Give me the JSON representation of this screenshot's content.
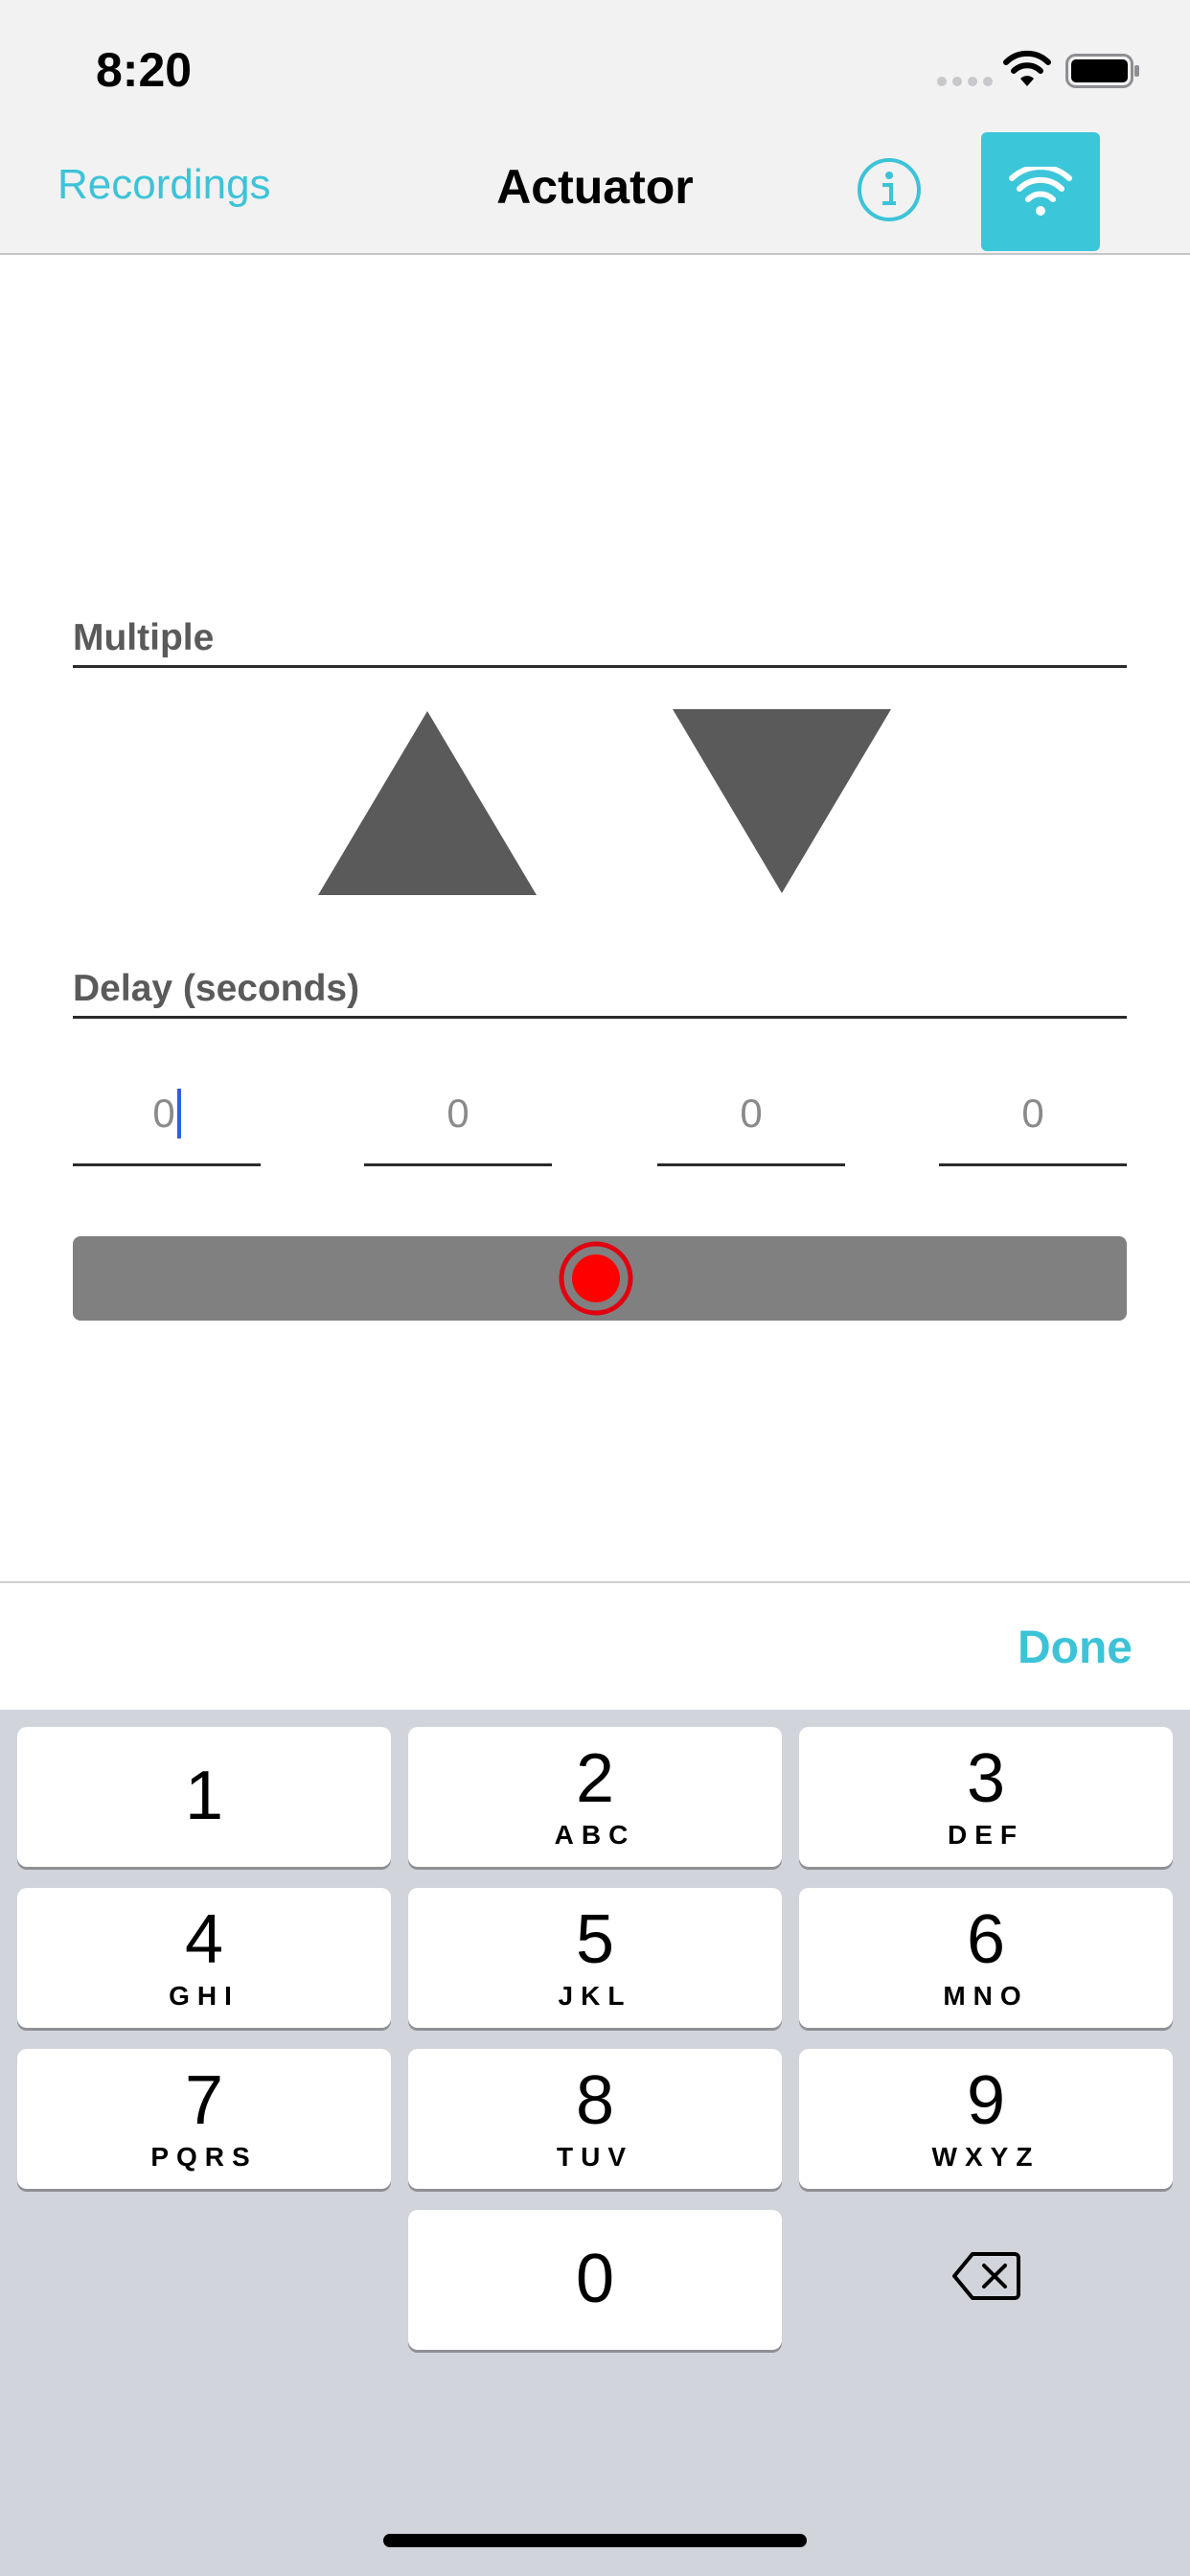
{
  "status_bar": {
    "time": "8:20"
  },
  "nav": {
    "back_label": "Recordings",
    "title": "Actuator",
    "accent_color": "#3cc3d8"
  },
  "main": {
    "multiple_label": "Multiple",
    "delay_label": "Delay (seconds)",
    "delay_fields": [
      "0",
      "0",
      "0",
      "0"
    ],
    "record_color": "#ff0000"
  },
  "accessory": {
    "done_label": "Done"
  },
  "keyboard": {
    "keys": [
      {
        "digit": "1",
        "letters": ""
      },
      {
        "digit": "2",
        "letters": "ABC"
      },
      {
        "digit": "3",
        "letters": "DEF"
      },
      {
        "digit": "4",
        "letters": "GHI"
      },
      {
        "digit": "5",
        "letters": "JKL"
      },
      {
        "digit": "6",
        "letters": "MNO"
      },
      {
        "digit": "7",
        "letters": "PQRS"
      },
      {
        "digit": "8",
        "letters": "TUV"
      },
      {
        "digit": "9",
        "letters": "WXYZ"
      },
      {
        "digit": "0",
        "letters": ""
      }
    ]
  }
}
